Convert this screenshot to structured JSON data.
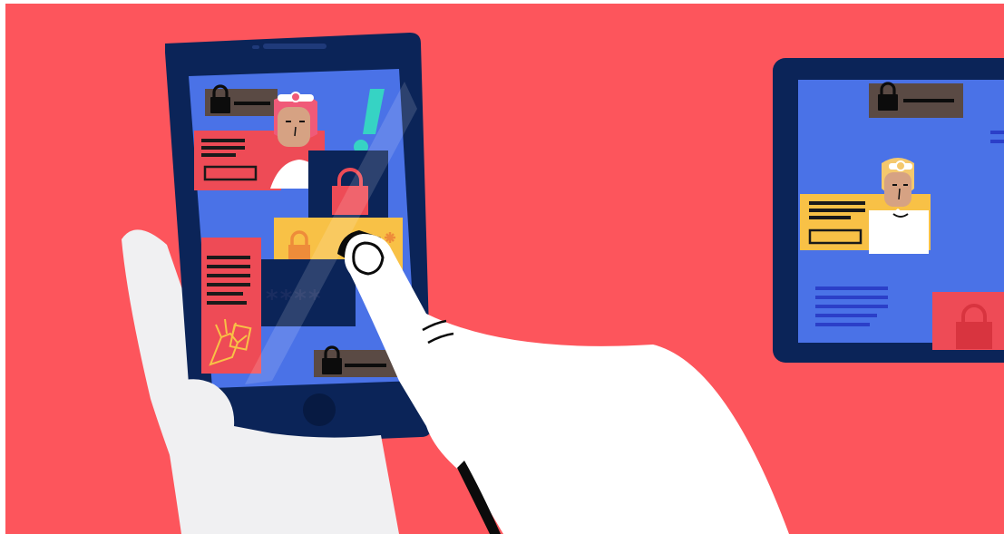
{
  "scene": {
    "description_type": "illustration",
    "colors": {
      "background": "#fd555c",
      "device_frame": "#0b2458",
      "screen": "#4a72e7",
      "card_brown": "#5a4a44",
      "card_red": "#ee4b56",
      "card_yellow": "#f8c146",
      "accent_teal": "#36d3c4",
      "hand": "#f0f0f2",
      "skin": "#d6a283",
      "hair_pink": "#f05a78",
      "hair_blond": "#f4c86d",
      "doctor_coat": "#ffffff",
      "text_lines": "#1a1a1a"
    }
  },
  "phone": {
    "masked_password": "****",
    "alert_symbol": "!"
  },
  "icons": {
    "lock": "lock-icon",
    "shopping_bag": "shopping-bag-icon",
    "doctor": "doctor-avatar-icon",
    "xray_hand": "xray-hand-icon",
    "home_button": "home-button-icon"
  }
}
